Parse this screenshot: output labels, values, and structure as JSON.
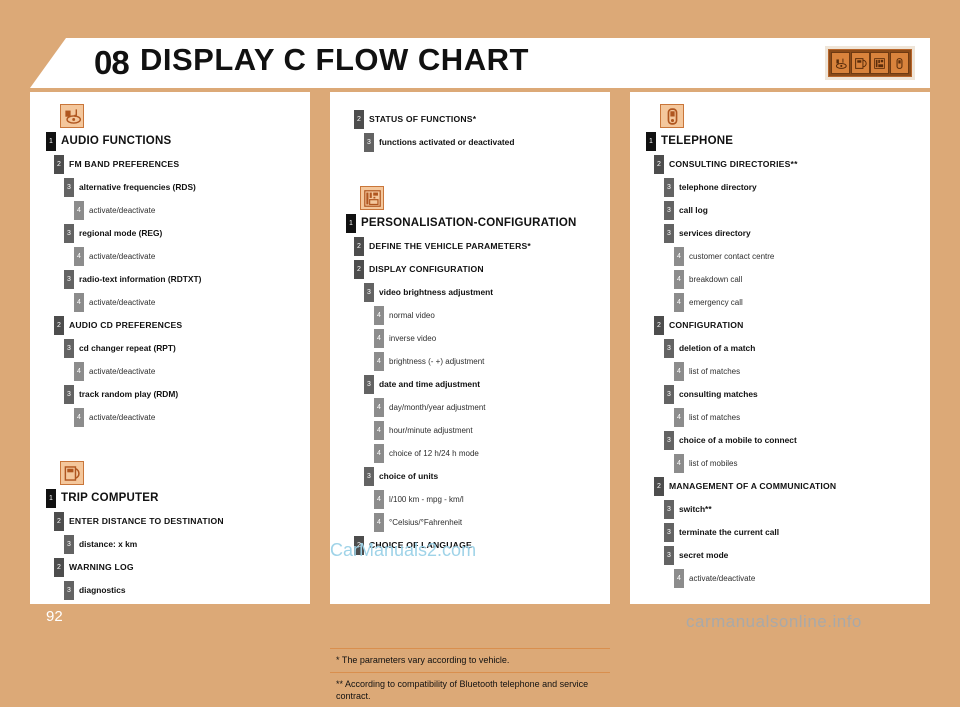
{
  "header": {
    "chapter_number": "08",
    "title": "DISPLAY C FLOW CHART",
    "icons": [
      "audio-icon",
      "trip-computer-icon",
      "personalisation-icon",
      "telephone-icon"
    ]
  },
  "page_number": "92",
  "watermarks": {
    "middle": "CarManuals2.com",
    "bottom": "carmanualsonline.info"
  },
  "columns": {
    "left": {
      "sections": [
        {
          "icon": "audio-icon",
          "rows": [
            {
              "level": 1,
              "label": "AUDIO FUNCTIONS"
            },
            {
              "level": 2,
              "label": "FM BAND PREFERENCES"
            },
            {
              "level": 3,
              "label": "alternative frequencies (RDS)"
            },
            {
              "level": 4,
              "label": "activate/deactivate"
            },
            {
              "level": 3,
              "label": "regional mode (REG)"
            },
            {
              "level": 4,
              "label": "activate/deactivate"
            },
            {
              "level": 3,
              "label": "radio-text information (RDTXT)"
            },
            {
              "level": 4,
              "label": "activate/deactivate"
            },
            {
              "level": 2,
              "label": "AUDIO CD PREFERENCES"
            },
            {
              "level": 3,
              "label": "cd changer repeat (RPT)"
            },
            {
              "level": 4,
              "label": "activate/deactivate"
            },
            {
              "level": 3,
              "label": "track random play (RDM)"
            },
            {
              "level": 4,
              "label": "activate/deactivate"
            }
          ]
        },
        {
          "icon": "trip-computer-icon",
          "rows": [
            {
              "level": 1,
              "label": "TRIP COMPUTER"
            },
            {
              "level": 2,
              "label": "ENTER DISTANCE TO DESTINATION"
            },
            {
              "level": 3,
              "label": "distance: x km"
            },
            {
              "level": 2,
              "label": "WARNING LOG"
            },
            {
              "level": 3,
              "label": "diagnostics"
            }
          ]
        }
      ]
    },
    "middle": {
      "sections": [
        {
          "icon": null,
          "rows": [
            {
              "level": 2,
              "label": "STATUS OF FUNCTIONS*"
            },
            {
              "level": 3,
              "label": "functions activated or deactivated"
            }
          ]
        },
        {
          "icon": "personalisation-icon",
          "rows": [
            {
              "level": 1,
              "label": "PERSONALISATION-CONFIGURATION"
            },
            {
              "level": 2,
              "label": "DEFINE THE VEHICLE PARAMETERS*"
            },
            {
              "level": 2,
              "label": "DISPLAY CONFIGURATION"
            },
            {
              "level": 3,
              "label": "video brightness adjustment"
            },
            {
              "level": 4,
              "label": "normal video"
            },
            {
              "level": 4,
              "label": "inverse video"
            },
            {
              "level": 4,
              "label": "brightness (- +) adjustment"
            },
            {
              "level": 3,
              "label": "date and time adjustment"
            },
            {
              "level": 4,
              "label": "day/month/year adjustment"
            },
            {
              "level": 4,
              "label": "hour/minute adjustment"
            },
            {
              "level": 4,
              "label": "choice of 12 h/24 h mode"
            },
            {
              "level": 3,
              "label": "choice of units"
            },
            {
              "level": 4,
              "label": "l/100 km - mpg - km/l"
            },
            {
              "level": 4,
              "label": "°Celsius/°Fahrenheit"
            },
            {
              "level": 2,
              "label": "CHOICE OF LANGUAGE"
            }
          ]
        }
      ],
      "footnotes": [
        {
          "marker": "*",
          "text": "The parameters vary according to vehicle."
        },
        {
          "marker": "**",
          "text": "According to compatibility of Bluetooth telephone and service contract."
        }
      ]
    },
    "right": {
      "sections": [
        {
          "icon": "telephone-icon",
          "rows": [
            {
              "level": 1,
              "label": "TELEPHONE"
            },
            {
              "level": 2,
              "label": "CONSULTING DIRECTORIES**"
            },
            {
              "level": 3,
              "label": "telephone directory"
            },
            {
              "level": 3,
              "label": "call log"
            },
            {
              "level": 3,
              "label": "services directory"
            },
            {
              "level": 4,
              "label": "customer contact centre"
            },
            {
              "level": 4,
              "label": "breakdown call"
            },
            {
              "level": 4,
              "label": "emergency call"
            },
            {
              "level": 2,
              "label": "CONFIGURATION"
            },
            {
              "level": 3,
              "label": "deletion of a match"
            },
            {
              "level": 4,
              "label": "list of matches"
            },
            {
              "level": 3,
              "label": "consulting matches"
            },
            {
              "level": 4,
              "label": "list of matches"
            },
            {
              "level": 3,
              "label": "choice of a mobile to connect"
            },
            {
              "level": 4,
              "label": "list of mobiles"
            },
            {
              "level": 2,
              "label": "MANAGEMENT OF A COMMUNICATION"
            },
            {
              "level": 3,
              "label": "switch**"
            },
            {
              "level": 3,
              "label": "terminate the current call"
            },
            {
              "level": 3,
              "label": "secret mode"
            },
            {
              "level": 4,
              "label": "activate/deactivate"
            }
          ]
        }
      ]
    }
  },
  "colors": {
    "page_background": "#dca977",
    "panel_background": "#ffffff",
    "icon_fill": "#f4c79c",
    "icon_stroke": "#c9763a",
    "marker_level1": "#111111",
    "marker_level2": "#4d4d4d",
    "marker_level3": "#636363",
    "marker_level4": "#8c8c8c",
    "footnote_rule": "#d98f4e",
    "watermark_middle": "#9fd3e8",
    "watermark_bottom": "#a9a9a9"
  }
}
